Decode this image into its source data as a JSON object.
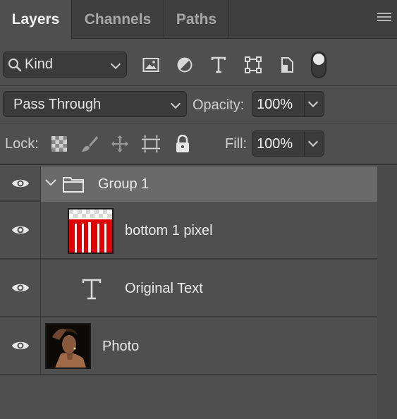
{
  "tabs": [
    {
      "label": "Layers",
      "active": true
    },
    {
      "label": "Channels",
      "active": false
    },
    {
      "label": "Paths",
      "active": false
    }
  ],
  "filter": {
    "kind_label": "Kind",
    "icons": [
      "image-filter-icon",
      "adjustment-filter-icon",
      "type-filter-icon",
      "shape-filter-icon",
      "smart-object-filter-icon"
    ]
  },
  "blend": {
    "mode": "Pass Through",
    "opacity_label": "Opacity:",
    "opacity_value": "100%"
  },
  "lock": {
    "label": "Lock:",
    "fill_label": "Fill:",
    "fill_value": "100%"
  },
  "layers": [
    {
      "name": "Group 1",
      "type": "group",
      "visible": true,
      "expanded": true,
      "selected": true
    },
    {
      "name": "bottom 1 pixel",
      "type": "pixel",
      "visible": true
    },
    {
      "name": "Original Text",
      "type": "text",
      "visible": true
    },
    {
      "name": "Photo",
      "type": "photo",
      "visible": true
    }
  ],
  "colors": {
    "panel_bg": "#4f4f4f",
    "selected_row": "#6a6a6a",
    "thumb_red": "#e00000"
  }
}
